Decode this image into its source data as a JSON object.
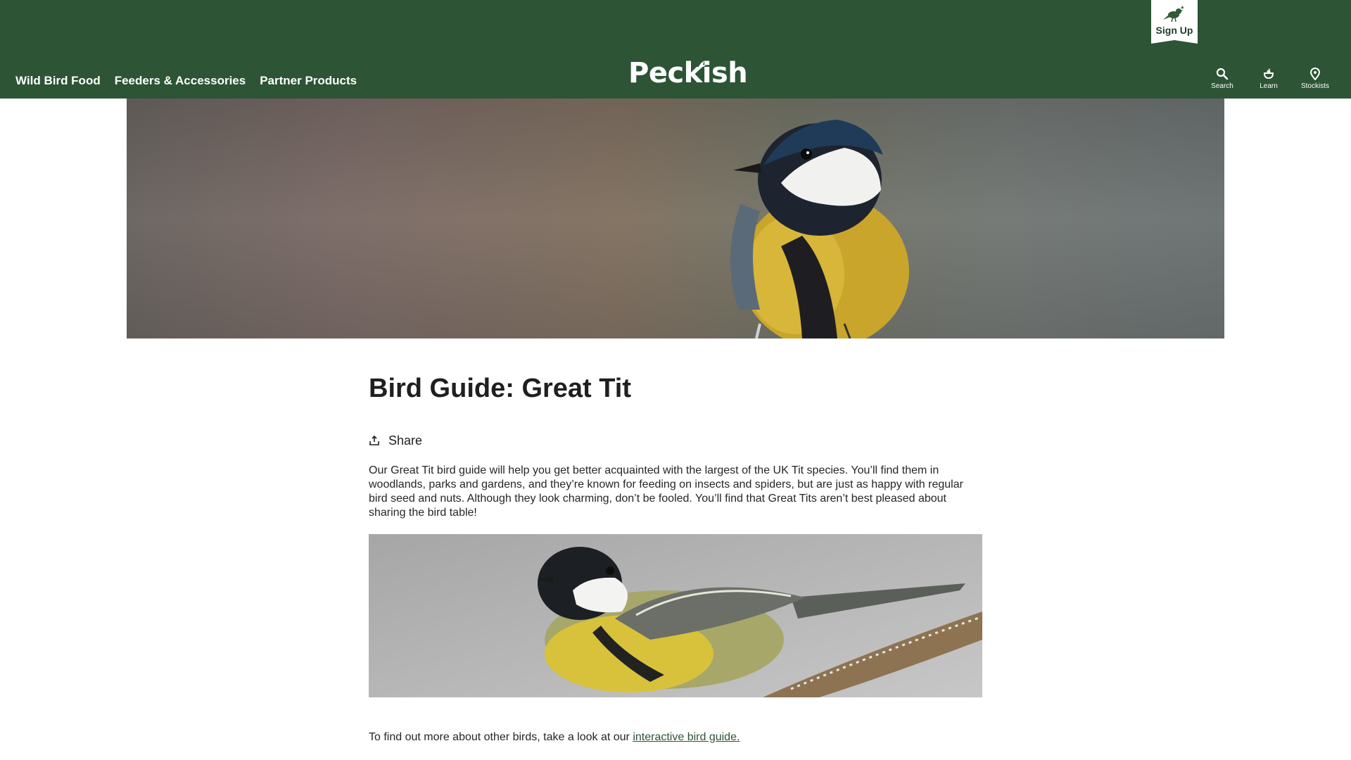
{
  "header": {
    "nav": [
      {
        "label": "Wild Bird Food"
      },
      {
        "label": "Feeders & Accessories"
      },
      {
        "label": "Partner Products"
      }
    ],
    "logo_text": "Peckish",
    "signup_label": "Sign Up",
    "utility": [
      {
        "label": "Search",
        "icon": "search-icon"
      },
      {
        "label": "Learn",
        "icon": "learn-icon"
      },
      {
        "label": "Stockists",
        "icon": "map-pin-icon"
      }
    ]
  },
  "hero": {
    "image": "great-tit-hero-photo"
  },
  "article": {
    "title": "Bird Guide: Great Tit",
    "share_label": "Share",
    "intro": "Our Great Tit bird guide will help you get better acquainted with the largest of the UK Tit species. You’ll find them in woodlands, parks and gardens, and they’re known for feeding on insects and spiders, but are just as happy with regular bird seed and nuts. Although they look charming, don’t be fooled. You’ll find that Great Tits aren’t best pleased about sharing the bird table!",
    "outro_prefix": "To find out more about other birds, take a look at our ",
    "outro_link": "interactive bird guide."
  },
  "colors": {
    "header_bg": "#2c5435",
    "link": "#2c5435",
    "text": "#1f1f1f"
  }
}
